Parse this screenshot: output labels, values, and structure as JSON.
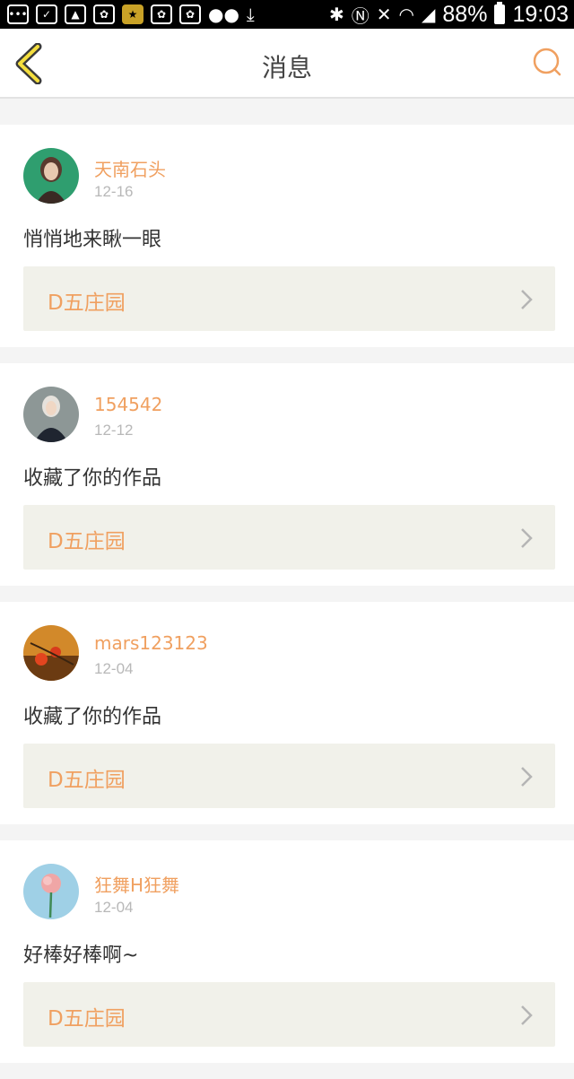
{
  "status_bar": {
    "battery": "88%",
    "time": "19:03",
    "icons": [
      "message-icon",
      "edit-icon",
      "image-icon",
      "paw-icon",
      "star-icon",
      "paw-icon",
      "paw-icon",
      "wechat-icon",
      "download-icon",
      "bluetooth-icon",
      "nfc-icon",
      "mute-icon",
      "wifi-icon",
      "signal-icon",
      "battery-icon"
    ]
  },
  "header": {
    "title": "消息",
    "back_icon": "chevron-left-icon",
    "search_icon": "search-icon"
  },
  "accent_color": "#f0a060",
  "messages": [
    {
      "username": "天南石头",
      "date": "12-16",
      "text": "悄悄地来瞅一眼",
      "work": "D五庄园"
    },
    {
      "username": "154542",
      "date": "12-12",
      "text": "收藏了你的作品",
      "work": "D五庄园"
    },
    {
      "username": "mars123123",
      "date": "12-04",
      "text": "收藏了你的作品",
      "work": "D五庄园"
    },
    {
      "username": "狂舞H狂舞",
      "date": "12-04",
      "text": "好棒好棒啊~",
      "work": "D五庄园"
    }
  ]
}
